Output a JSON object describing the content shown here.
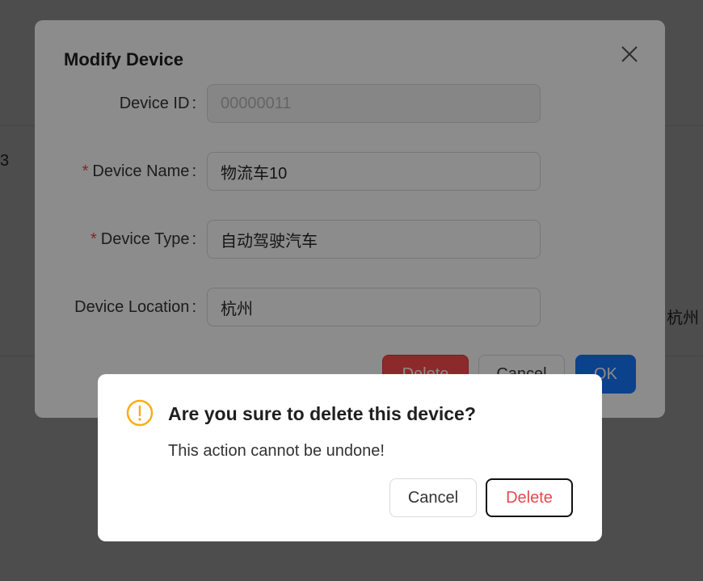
{
  "background": {
    "partial_text_left": "3",
    "partial_text_right": "杭州"
  },
  "modal": {
    "title": "Modify Device",
    "fields": [
      {
        "label": "Device ID",
        "required": false,
        "value": "00000011",
        "disabled": true
      },
      {
        "label": "Device Name",
        "required": true,
        "value": "物流车10",
        "disabled": false
      },
      {
        "label": "Device Type",
        "required": true,
        "value": "自动驾驶汽车",
        "disabled": false
      },
      {
        "label": "Device Location",
        "required": false,
        "value": "杭州",
        "disabled": false
      }
    ],
    "buttons": {
      "delete": "Delete",
      "cancel": "Cancel",
      "ok": "OK"
    }
  },
  "confirm": {
    "icon": "exclamation-circle-icon",
    "title": "Are you sure to delete this device?",
    "content": "This action cannot be undone!",
    "cancel_label": "Cancel",
    "delete_label": "Delete"
  },
  "colors": {
    "primary": "#1677ff",
    "danger": "#ff4d4f",
    "warning": "#faad14",
    "required_mark": "#e5484d"
  },
  "required_mark": "*",
  "colon": ":"
}
